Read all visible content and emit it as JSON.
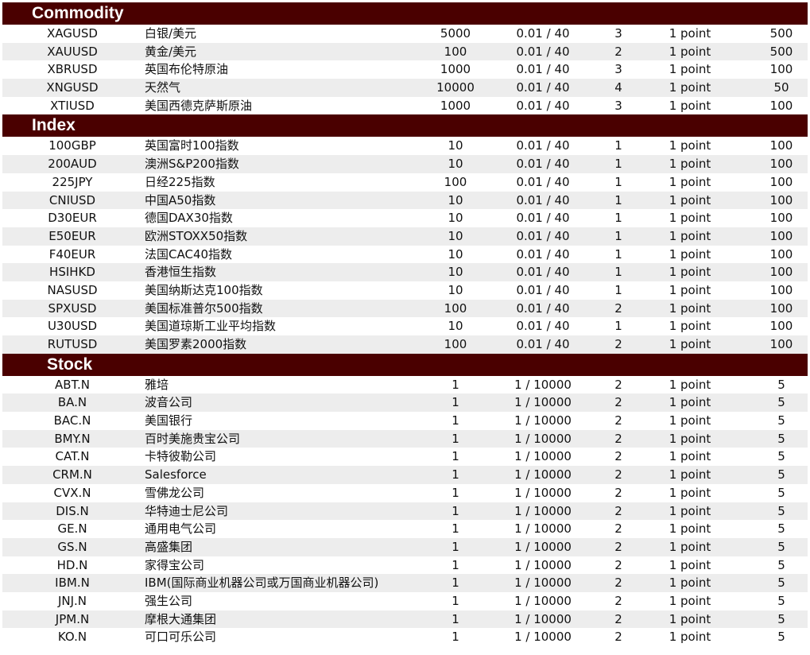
{
  "sections": [
    {
      "title": "Commodity",
      "rows": [
        [
          "XAGUSD",
          "白银/美元",
          "5000",
          "0.01 / 40",
          "3",
          "1 point",
          "500"
        ],
        [
          "XAUUSD",
          "黄金/美元",
          "100",
          "0.01 / 40",
          "2",
          "1 point",
          "500"
        ],
        [
          "XBRUSD",
          "英国布伦特原油",
          "1000",
          "0.01 / 40",
          "3",
          "1 point",
          "100"
        ],
        [
          "XNGUSD",
          "天然气",
          "10000",
          "0.01 / 40",
          "4",
          "1 point",
          "50"
        ],
        [
          "XTIUSD",
          "美国西德克萨斯原油",
          "1000",
          "0.01 / 40",
          "3",
          "1 point",
          "100"
        ]
      ]
    },
    {
      "title": "Index",
      "rows": [
        [
          "100GBP",
          "英国富时100指数",
          "10",
          "0.01 / 40",
          "1",
          "1 point",
          "100"
        ],
        [
          "200AUD",
          "澳洲S&P200指数",
          "10",
          "0.01 / 40",
          "1",
          "1 point",
          "100"
        ],
        [
          "225JPY",
          "日经225指数",
          "100",
          "0.01 / 40",
          "1",
          "1 point",
          "100"
        ],
        [
          "CNIUSD",
          "中国A50指数",
          "10",
          "0.01 / 40",
          "1",
          "1 point",
          "100"
        ],
        [
          "D30EUR",
          "德国DAX30指数",
          "10",
          "0.01 / 40",
          "1",
          "1 point",
          "100"
        ],
        [
          "E50EUR",
          "欧洲STOXX50指数",
          "10",
          "0.01 / 40",
          "1",
          "1 point",
          "100"
        ],
        [
          "F40EUR",
          "法国CAC40指数",
          "10",
          "0.01 / 40",
          "1",
          "1 point",
          "100"
        ],
        [
          "HSIHKD",
          "香港恒生指数",
          "10",
          "0.01 / 40",
          "1",
          "1 point",
          "100"
        ],
        [
          "NASUSD",
          "美国纳斯达克100指数",
          "10",
          "0.01 / 40",
          "1",
          "1 point",
          "100"
        ],
        [
          "SPXUSD",
          "美国标准普尔500指数",
          "100",
          "0.01 / 40",
          "2",
          "1 point",
          "100"
        ],
        [
          "U30USD",
          "美国道琼斯工业平均指数",
          "10",
          "0.01 / 40",
          "1",
          "1 point",
          "100"
        ],
        [
          "RUTUSD",
          "美国罗素2000指数",
          "100",
          "0.01 / 40",
          "2",
          "1 point",
          "100"
        ]
      ]
    },
    {
      "title": "Stock",
      "rows": [
        [
          "ABT.N",
          "雅培",
          "1",
          "1 / 10000",
          "2",
          "1 point",
          "5"
        ],
        [
          "BA.N",
          "波音公司",
          "1",
          "1 / 10000",
          "2",
          "1 point",
          "5"
        ],
        [
          "BAC.N",
          "美国银行",
          "1",
          "1 / 10000",
          "2",
          "1 point",
          "5"
        ],
        [
          "BMY.N",
          "百时美施贵宝公司",
          "1",
          "1 / 10000",
          "2",
          "1 point",
          "5"
        ],
        [
          "CAT.N",
          "卡特彼勒公司",
          "1",
          "1 / 10000",
          "2",
          "1 point",
          "5"
        ],
        [
          "CRM.N",
          "Salesforce",
          "1",
          "1 / 10000",
          "2",
          "1 point",
          "5"
        ],
        [
          "CVX.N",
          "雪佛龙公司",
          "1",
          "1 / 10000",
          "2",
          "1 point",
          "5"
        ],
        [
          "DIS.N",
          "华特迪士尼公司",
          "1",
          "1 / 10000",
          "2",
          "1 point",
          "5"
        ],
        [
          "GE.N",
          "通用电气公司",
          "1",
          "1 / 10000",
          "2",
          "1 point",
          "5"
        ],
        [
          "GS.N",
          "高盛集团",
          "1",
          "1 / 10000",
          "2",
          "1 point",
          "5"
        ],
        [
          "HD.N",
          "家得宝公司",
          "1",
          "1 / 10000",
          "2",
          "1 point",
          "5"
        ],
        [
          "IBM.N",
          "IBM(国际商业机器公司或万国商业机器公司)",
          "1",
          "1 / 10000",
          "2",
          "1 point",
          "5"
        ],
        [
          "JNJ.N",
          "强生公司",
          "1",
          "1 / 10000",
          "2",
          "1 point",
          "5"
        ],
        [
          "JPM.N",
          "摩根大通集团",
          "1",
          "1 / 10000",
          "2",
          "1 point",
          "5"
        ],
        [
          "KO.N",
          "可口可乐公司",
          "1",
          "1 / 10000",
          "2",
          "1 point",
          "5"
        ]
      ]
    }
  ],
  "colors": {
    "header_bg": "#4a0000",
    "header_text": "#ffffff",
    "row_alt_bg": "#ededed"
  }
}
